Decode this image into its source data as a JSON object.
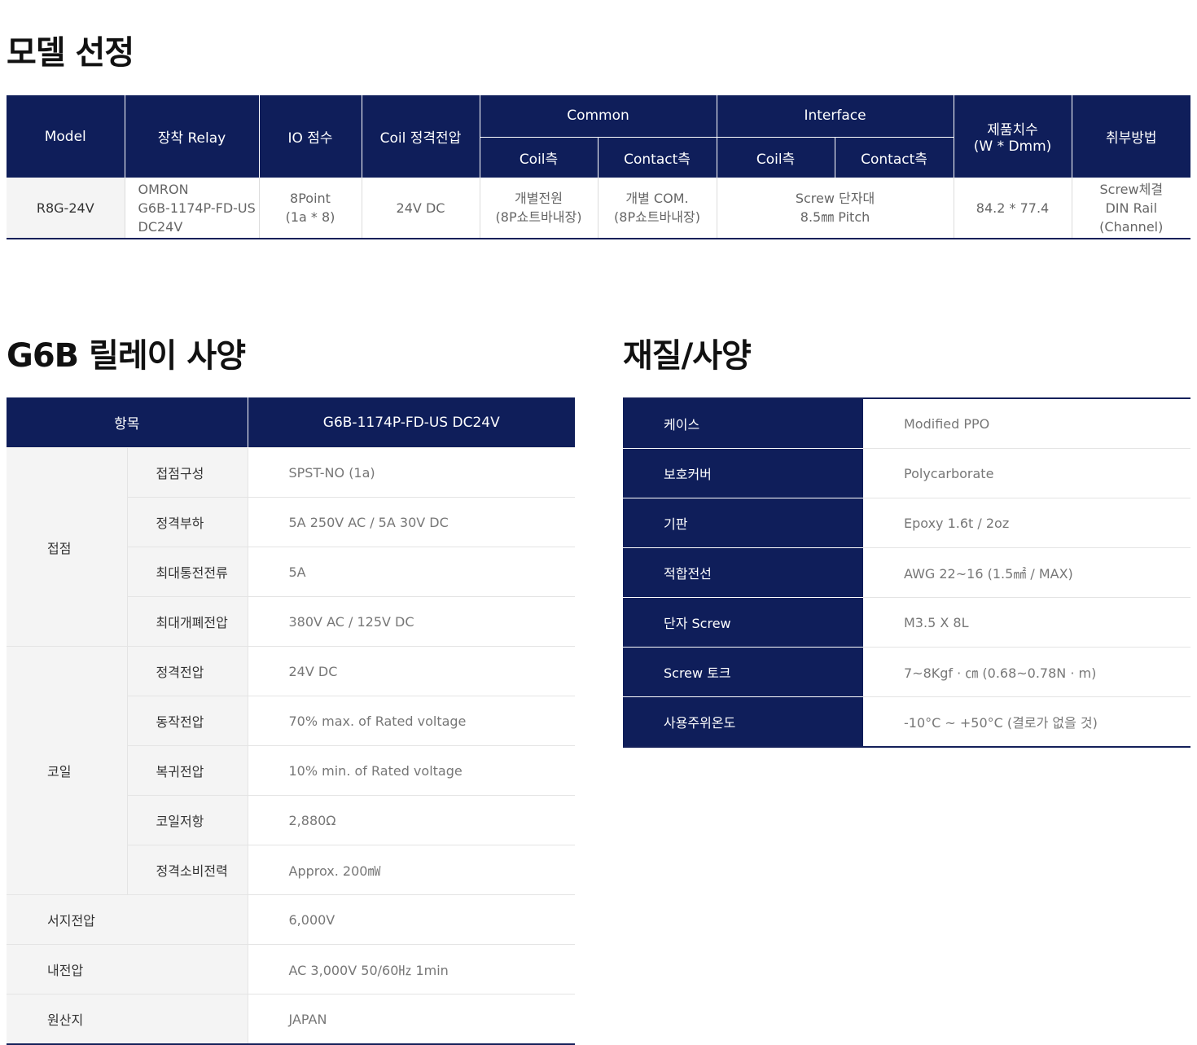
{
  "model_section": {
    "title": "모델 선정",
    "headers": {
      "model": "Model",
      "relay": "장착 Relay",
      "io": "IO 점수",
      "coil_voltage": "Coil 정격전압",
      "common": "Common",
      "interface": "Interface",
      "dimensions": [
        "제품치수",
        "(W * Dmm)"
      ],
      "mounting": "취부방법",
      "common_coil": "Coil측",
      "common_contact": "Contact측",
      "interface_coil": "Coil측",
      "interface_contact": "Contact측"
    },
    "row": {
      "model": "R8G-24V",
      "relay": [
        "OMRON",
        "G6B-1174P-FD-US",
        "DC24V"
      ],
      "io": [
        "8Point",
        "(1a * 8)"
      ],
      "coil_voltage": "24V DC",
      "common_coil": [
        "개별전원",
        "(8P쇼트바내장)"
      ],
      "common_contact": [
        "개별 COM.",
        "(8P쇼트바내장)"
      ],
      "interface": [
        "Screw 단자대",
        "8.5㎜ Pitch"
      ],
      "dimensions": "84.2 * 77.4",
      "mounting": [
        "Screw체결",
        "DIN Rail",
        "(Channel)"
      ]
    }
  },
  "relay_section": {
    "title": "G6B 릴레이 사양",
    "header": {
      "item": "항목",
      "model": "G6B-1174P-FD-US DC24V"
    },
    "contact_group": {
      "label": "접점",
      "rows": [
        {
          "name": "접점구성",
          "value": "SPST-NO (1a)"
        },
        {
          "name": "정격부하",
          "value": "5A 250V AC / 5A 30V DC"
        },
        {
          "name": "최대통전전류",
          "value": "5A"
        },
        {
          "name": "최대개폐전압",
          "value": "380V AC / 125V DC"
        }
      ]
    },
    "coil_group": {
      "label": "코일",
      "rows": [
        {
          "name": "정격전압",
          "value": "24V DC"
        },
        {
          "name": "동작전압",
          "value": "70% max. of Rated voltage"
        },
        {
          "name": "복귀전압",
          "value": "10% min. of Rated voltage"
        },
        {
          "name": "코일저항",
          "value": "2,880Ω"
        },
        {
          "name": "정격소비전력",
          "value": "Approx. 200㎽"
        }
      ]
    },
    "single_rows": [
      {
        "name": "서지전압",
        "value": "6,000V"
      },
      {
        "name": "내전압",
        "value": "AC 3,000V 50/60㎐ 1min"
      },
      {
        "name": "원산지",
        "value": "JAPAN"
      }
    ]
  },
  "material_section": {
    "title": "재질/사양",
    "rows": [
      {
        "label": "케이스",
        "value": "Modified PPO"
      },
      {
        "label": "보호커버",
        "value": "Polycarborate"
      },
      {
        "label": "기판",
        "value": "Epoxy 1.6t / 2oz"
      },
      {
        "label": "적합전선",
        "value": "AWG 22~16 (1.5㎟ / MAX)"
      },
      {
        "label": "단자 Screw",
        "value": "M3.5 X 8L"
      },
      {
        "label": "Screw 토크",
        "value": "7~8Kgf · ㎝ (0.68~0.78N · m)"
      },
      {
        "label": "사용주위온도",
        "value": "-10°C ~ +50°C (결로가 없을 것)"
      }
    ]
  },
  "colors": {
    "navy": "#0f1e5a",
    "row_bg": "#f4f4f4",
    "value_text": "#777777"
  }
}
